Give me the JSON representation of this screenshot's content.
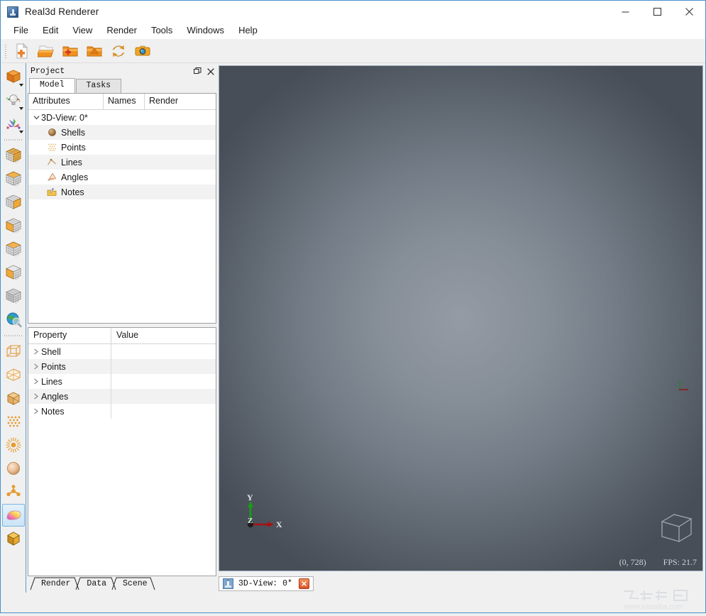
{
  "window": {
    "title": "Real3d Renderer",
    "icon": "app-icon",
    "minimize_label": "Minimize",
    "maximize_label": "Maximize",
    "close_label": "Close"
  },
  "menu": {
    "items": [
      {
        "label": "File"
      },
      {
        "label": "Edit"
      },
      {
        "label": "View"
      },
      {
        "label": "Render"
      },
      {
        "label": "Tools"
      },
      {
        "label": "Windows"
      },
      {
        "label": "Help"
      }
    ]
  },
  "toolbar": {
    "buttons": [
      {
        "name": "new-document-icon",
        "label": "New"
      },
      {
        "name": "open-document-icon",
        "label": "Open"
      },
      {
        "name": "add-folder-icon",
        "label": "Add"
      },
      {
        "name": "import-folder-icon",
        "label": "Import"
      },
      {
        "name": "refresh-icon",
        "label": "Refresh"
      },
      {
        "name": "camera-icon",
        "label": "Snapshot"
      }
    ]
  },
  "left_toolbar": {
    "buttons": [
      {
        "name": "solid-cube-icon",
        "label": "Render Mode",
        "dropdown": true,
        "selected": false
      },
      {
        "name": "light-bulb-icon",
        "label": "Lighting",
        "dropdown": true,
        "selected": false
      },
      {
        "name": "axes-icon",
        "label": "Axes",
        "dropdown": true,
        "selected": false
      },
      {
        "name": "grid-cube-full-icon",
        "label": "Grid Full",
        "dropdown": false,
        "selected": false
      },
      {
        "name": "grid-cube-top-icon",
        "label": "Grid Top",
        "dropdown": false,
        "selected": false
      },
      {
        "name": "grid-cube-right-icon",
        "label": "Grid Right",
        "dropdown": false,
        "selected": false
      },
      {
        "name": "grid-cube-left-icon",
        "label": "Grid Left",
        "dropdown": false,
        "selected": false
      },
      {
        "name": "grid-cube-bottom-icon",
        "label": "Grid Bottom",
        "dropdown": false,
        "selected": false
      },
      {
        "name": "grid-cube-slice-icon",
        "label": "Grid Slice",
        "dropdown": false,
        "selected": false
      },
      {
        "name": "grid-cube-gray-icon",
        "label": "Grid Gray",
        "dropdown": false,
        "selected": false
      },
      {
        "name": "globe-search-icon",
        "label": "Explore",
        "dropdown": false,
        "selected": false
      },
      {
        "name": "wireframe-box-icon",
        "label": "Wireframe Box",
        "dropdown": false,
        "selected": false
      },
      {
        "name": "hull-box-icon",
        "label": "Hull Box",
        "dropdown": false,
        "selected": false
      },
      {
        "name": "filled-box-icon",
        "label": "Filled Box",
        "dropdown": false,
        "selected": false
      },
      {
        "name": "point-cloud-icon",
        "label": "Point Cloud",
        "dropdown": false,
        "selected": false
      },
      {
        "name": "burst-icon",
        "label": "Burst",
        "dropdown": false,
        "selected": false
      },
      {
        "name": "sphere-icon",
        "label": "Sphere",
        "dropdown": false,
        "selected": false
      },
      {
        "name": "molecule-icon",
        "label": "Molecule",
        "dropdown": false,
        "selected": false
      },
      {
        "name": "color-palette-icon",
        "label": "Color Map",
        "dropdown": false,
        "selected": true
      },
      {
        "name": "gold-cube-icon",
        "label": "Material",
        "dropdown": false,
        "selected": false
      }
    ]
  },
  "project_panel": {
    "title": "Project",
    "float_label": "Float",
    "close_label": "Close",
    "tabs": [
      {
        "label": "Model",
        "active": true
      },
      {
        "label": "Tasks",
        "active": false
      }
    ],
    "tree": {
      "columns": [
        {
          "label": "Attributes"
        },
        {
          "label": "Names"
        },
        {
          "label": "Render"
        }
      ],
      "root": {
        "label": "3D-View: 0*",
        "expanded": true
      },
      "children": [
        {
          "label": "Shells",
          "icon": "sphere-icon"
        },
        {
          "label": "Points",
          "icon": "points-grid-icon"
        },
        {
          "label": "Lines",
          "icon": "angle-lines-icon"
        },
        {
          "label": "Angles",
          "icon": "protractor-icon"
        },
        {
          "label": "Notes",
          "icon": "notes-folder-icon"
        }
      ]
    },
    "properties": {
      "columns": [
        {
          "label": "Property"
        },
        {
          "label": "Value"
        }
      ],
      "rows": [
        {
          "property": "Shell",
          "value": ""
        },
        {
          "property": "Points",
          "value": ""
        },
        {
          "property": "Lines",
          "value": ""
        },
        {
          "property": "Angles",
          "value": ""
        },
        {
          "property": "Notes",
          "value": ""
        }
      ]
    },
    "bottom_tabs": [
      {
        "label": "Render",
        "active": true
      },
      {
        "label": "Data",
        "active": false
      },
      {
        "label": "Scene",
        "active": false
      }
    ]
  },
  "viewport": {
    "gizmo": {
      "x_label": "X",
      "y_label": "Y",
      "z_label": "Z",
      "x_color": "#aa1111",
      "y_color": "#14a014",
      "z_color": "#1c1c1c"
    },
    "status": {
      "coordinates": "(0, 728)",
      "fps": "FPS: 21.7"
    },
    "nav_cube_label": "view-cube",
    "background_outer": "#474e57",
    "background_inner": "#949ba4"
  },
  "document_tabs": [
    {
      "label": "3D-View: 0*",
      "icon": "doc-3dview-icon",
      "close_label": "x",
      "active": true
    }
  ],
  "watermark": {
    "text": "www.xiazaiba.com"
  }
}
